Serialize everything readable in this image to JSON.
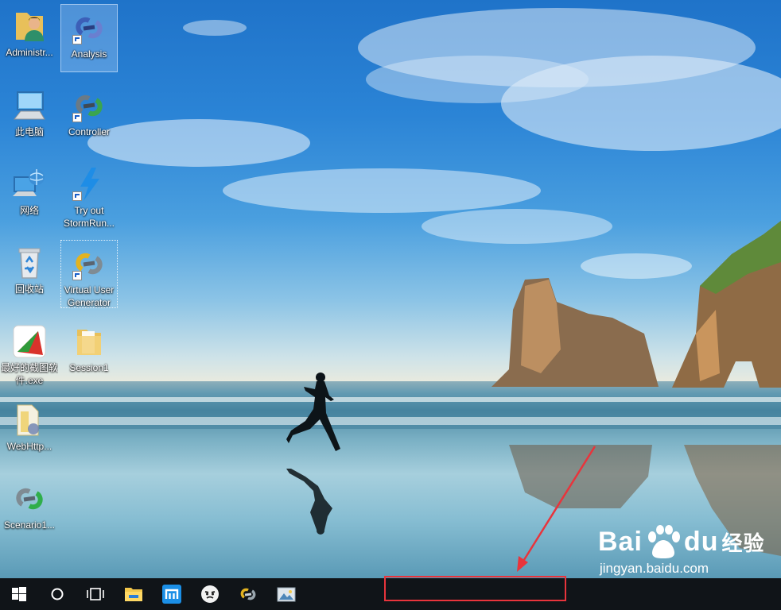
{
  "desktop": {
    "icons": [
      {
        "label": "Administr...",
        "icon": "user-folder-icon"
      },
      {
        "label": "Analysis",
        "icon": "loadrunner-analysis-icon"
      },
      {
        "label": "此电脑",
        "icon": "computer-icon"
      },
      {
        "label": "Controller",
        "icon": "loadrunner-controller-icon"
      },
      {
        "label": "网络",
        "icon": "network-icon"
      },
      {
        "label": "Try out StormRun...",
        "icon": "stormrunner-icon"
      },
      {
        "label": "回收站",
        "icon": "recycle-bin-icon"
      },
      {
        "label": "Virtual User Generator",
        "icon": "vugen-icon"
      },
      {
        "label": "最好的截图软件.exe",
        "icon": "screenshot-app-icon"
      },
      {
        "label": "Session1",
        "icon": "folder-icon"
      },
      {
        "label": "WebHttp...",
        "icon": "script-folder-icon"
      },
      {
        "label": "Scenario1...",
        "icon": "scenario-icon"
      }
    ]
  },
  "taskbar": {
    "buttons": [
      {
        "name": "start",
        "icon": "windows-logo-icon"
      },
      {
        "name": "search",
        "icon": "cortana-circle-icon"
      },
      {
        "name": "task-view",
        "icon": "task-view-icon"
      },
      {
        "name": "file-explorer",
        "icon": "file-explorer-icon"
      },
      {
        "name": "maxthon-browser",
        "icon": "maxthon-icon"
      },
      {
        "name": "app-face",
        "icon": "face-app-icon"
      },
      {
        "name": "loadrunner",
        "icon": "loadrunner-icon"
      },
      {
        "name": "screenshot-tool",
        "icon": "picture-tool-icon"
      }
    ],
    "highlight_color": "#e8343c"
  },
  "watermark": {
    "brand_left": "Bai",
    "brand_right": "du",
    "brand_cn": "经验",
    "url": "jingyan.baidu.com"
  },
  "colors": {
    "annotation_red": "#e8343c",
    "taskbar_bg": "#101418"
  }
}
